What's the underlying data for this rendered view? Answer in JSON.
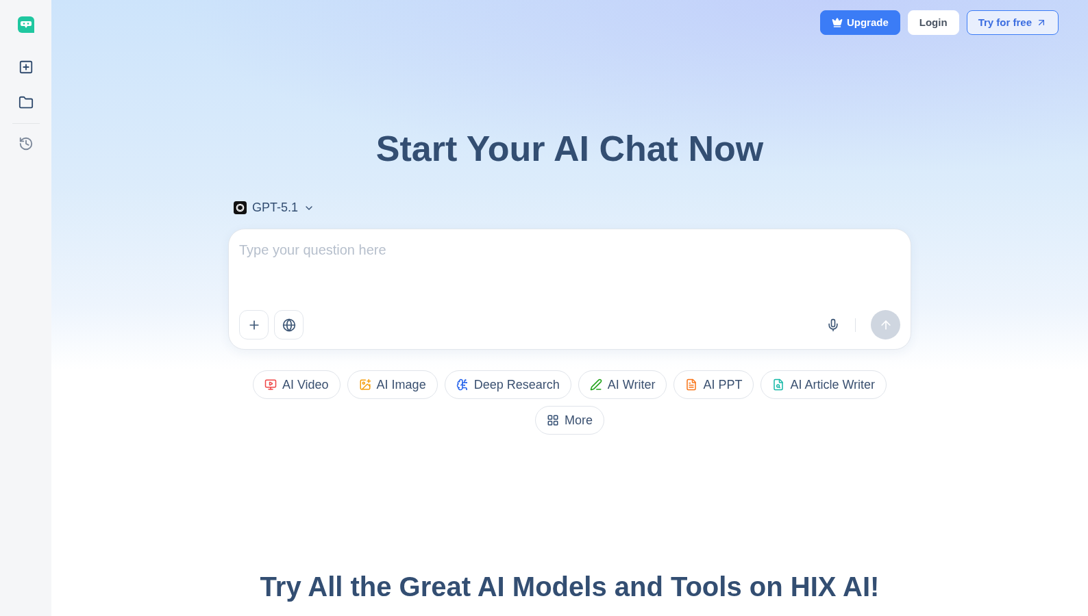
{
  "sidebar": {
    "items": [
      {
        "kind": "new-chat"
      },
      {
        "kind": "folder"
      },
      {
        "kind": "history"
      }
    ]
  },
  "header": {
    "buttons": [
      {
        "label": "Upgrade",
        "kind": "primary"
      },
      {
        "label": "Login",
        "kind": "plain"
      },
      {
        "label": "Try for free",
        "kind": "outline"
      }
    ]
  },
  "title": "Start Your AI Chat Now",
  "model_selector": {
    "label": "GPT-5.1"
  },
  "composer": {
    "placeholder": "Type your question here",
    "send_button": {
      "disabled": true
    }
  },
  "tools": [
    {
      "label": "AI Video",
      "kind": "video",
      "color": "#ef4444"
    },
    {
      "label": "AI Image",
      "kind": "image",
      "color": "#f59e0b"
    },
    {
      "label": "Deep Research",
      "kind": "research",
      "color": "#2563eb"
    },
    {
      "label": "AI Writer",
      "kind": "writer",
      "color": "#22a31a"
    },
    {
      "label": "AI PPT",
      "kind": "ppt",
      "color": "#f97316"
    },
    {
      "label": "AI Article Writer",
      "kind": "article",
      "color": "#14b8a6"
    },
    {
      "label": "More",
      "kind": "more",
      "color": "#334e72"
    }
  ],
  "section_heading": "Try All the Great AI Models and Tools on HIX AI!"
}
